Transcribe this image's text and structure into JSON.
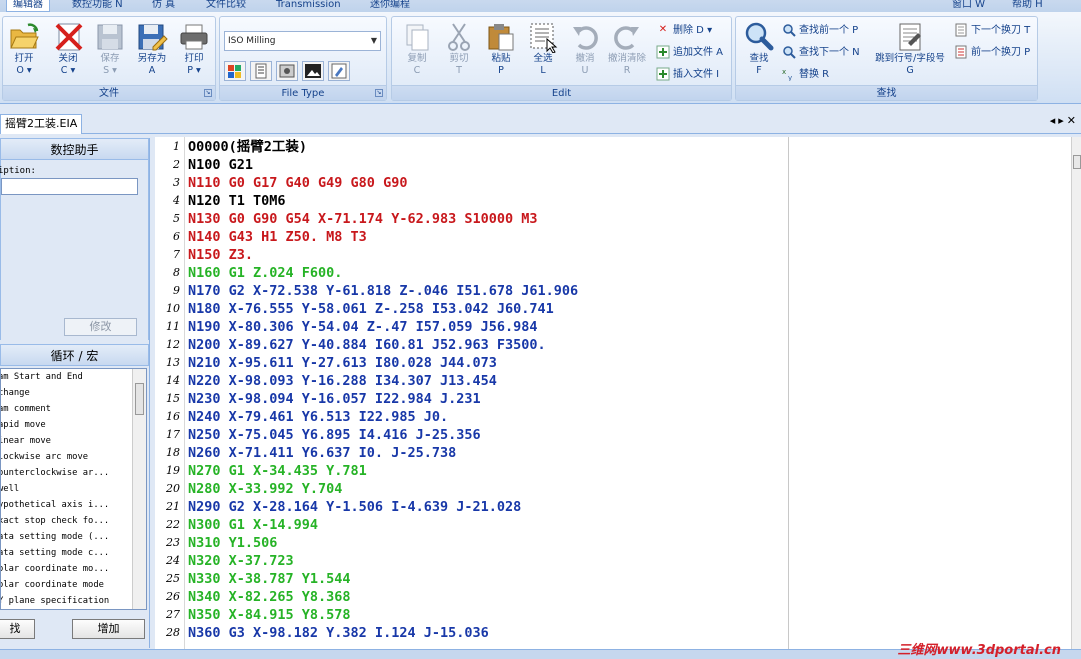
{
  "ribbon_tabs": [
    "编辑器",
    "数控功能 N",
    "仿 真",
    "文件比较",
    "Transmission",
    "迷你编程"
  ],
  "ribbon_tabs_right": [
    "窗口 W",
    "帮助 H"
  ],
  "file_group": {
    "label": "文件",
    "buttons": [
      {
        "label": "打开",
        "key": "O"
      },
      {
        "label": "关闭",
        "key": "C"
      },
      {
        "label": "保存",
        "key": "S"
      },
      {
        "label": "另存为",
        "key": "A"
      },
      {
        "label": "打印",
        "key": "P"
      }
    ]
  },
  "file_type_group": {
    "label": "File Type",
    "combo_value": "ISO Milling"
  },
  "edit_group": {
    "label": "Edit",
    "buttons": [
      {
        "label": "复制",
        "key": "C"
      },
      {
        "label": "剪切",
        "key": "T"
      },
      {
        "label": "粘贴",
        "key": "P"
      },
      {
        "label": "全选",
        "key": "L"
      },
      {
        "label": "撤消",
        "key": "U"
      },
      {
        "label": "撤消清除",
        "key": "R"
      }
    ],
    "small_buttons": [
      {
        "label": "删除 D"
      },
      {
        "label": "追加文件 A"
      },
      {
        "label": "插入文件 I"
      }
    ]
  },
  "find_group": {
    "label": "查找",
    "big_find": {
      "label": "查找",
      "key": "F"
    },
    "small_buttons": [
      {
        "label": "查找前一个 P"
      },
      {
        "label": "查找下一个 N"
      },
      {
        "label": "替换 R"
      }
    ],
    "goto": {
      "label": "跳到行号/字段号",
      "key": "G"
    },
    "nav_buttons": [
      {
        "label": "下一个换刀 T"
      },
      {
        "label": "前一个换刀 P"
      }
    ]
  },
  "document_tab": "摇臂2工装.EIA",
  "assistant": {
    "title": "数控助手",
    "description_label": "iption:",
    "modify_button": "修改"
  },
  "macro_panel": {
    "title": "循环 / 宏",
    "items": [
      "am Start and End",
      "change",
      "am comment",
      "apid move",
      "inear move",
      "lockwise arc move",
      "ounterclockwise ar...",
      "well",
      "ypothetical axis i...",
      "xact stop check fo...",
      "ata setting mode (...",
      "ata setting mode c...",
      "olar coordinate mo...",
      "olar coordinate mode",
      "Y plane specification"
    ],
    "find_button": "找",
    "add_button": "增加"
  },
  "colors": {
    "green": "#26b326",
    "blue": "#1838a8",
    "red": "#c8181c",
    "black": "#000000"
  },
  "editor": {
    "lines": [
      {
        "num": "1",
        "text": "O0000(摇臂2工装)",
        "color": "black"
      },
      {
        "num": "2",
        "text": "N100 G21",
        "color": "black"
      },
      {
        "num": "3",
        "text": "N110 G0 G17 G40 G49 G80 G90",
        "color": "red"
      },
      {
        "num": "4",
        "text": "N120 T1 T0M6",
        "color": "black"
      },
      {
        "num": "5",
        "text": "N130 G0 G90 G54 X-71.174 Y-62.983 S10000 M3",
        "color": "red"
      },
      {
        "num": "6",
        "text": "N140 G43 H1 Z50. M8 T3",
        "color": "red"
      },
      {
        "num": "7",
        "text": "N150 Z3.",
        "color": "red"
      },
      {
        "num": "8",
        "text": "N160 G1 Z.024 F600.",
        "color": "green"
      },
      {
        "num": "9",
        "text": "N170 G2 X-72.538 Y-61.818 Z-.046 I51.678 J61.906",
        "color": "blue"
      },
      {
        "num": "10",
        "text": "N180 X-76.555 Y-58.061 Z-.258 I53.042 J60.741",
        "color": "blue"
      },
      {
        "num": "11",
        "text": "N190 X-80.306 Y-54.04 Z-.47 I57.059 J56.984",
        "color": "blue"
      },
      {
        "num": "12",
        "text": "N200 X-89.627 Y-40.884 I60.81 J52.963 F3500.",
        "color": "blue"
      },
      {
        "num": "13",
        "text": "N210 X-95.611 Y-27.613 I80.028 J44.073",
        "color": "blue"
      },
      {
        "num": "14",
        "text": "N220 X-98.093 Y-16.288 I34.307 J13.454",
        "color": "blue"
      },
      {
        "num": "15",
        "text": "N230 X-98.094 Y-16.057 I22.984 J.231",
        "color": "blue"
      },
      {
        "num": "16",
        "text": "N240 X-79.461 Y6.513 I22.985 J0.",
        "color": "blue"
      },
      {
        "num": "17",
        "text": "N250 X-75.045 Y6.895 I4.416 J-25.356",
        "color": "blue"
      },
      {
        "num": "18",
        "text": "N260 X-71.411 Y6.637 I0. J-25.738",
        "color": "blue"
      },
      {
        "num": "19",
        "text": "N270 G1 X-34.435 Y.781",
        "color": "green"
      },
      {
        "num": "20",
        "text": "N280 X-33.992 Y.704",
        "color": "green"
      },
      {
        "num": "21",
        "text": "N290 G2 X-28.164 Y-1.506 I-4.639 J-21.028",
        "color": "blue"
      },
      {
        "num": "22",
        "text": "N300 G1 X-14.994",
        "color": "green"
      },
      {
        "num": "23",
        "text": "N310 Y1.506",
        "color": "green"
      },
      {
        "num": "24",
        "text": "N320 X-37.723",
        "color": "green"
      },
      {
        "num": "25",
        "text": "N330 X-38.787 Y1.544",
        "color": "green"
      },
      {
        "num": "26",
        "text": "N340 X-82.265 Y8.368",
        "color": "green"
      },
      {
        "num": "27",
        "text": "N350 X-84.915 Y8.578",
        "color": "green"
      },
      {
        "num": "28",
        "text": "N360 G3 X-98.182 Y.382 I.124 J-15.036",
        "color": "blue"
      }
    ]
  },
  "watermark": "三维网www.3dportal.cn"
}
